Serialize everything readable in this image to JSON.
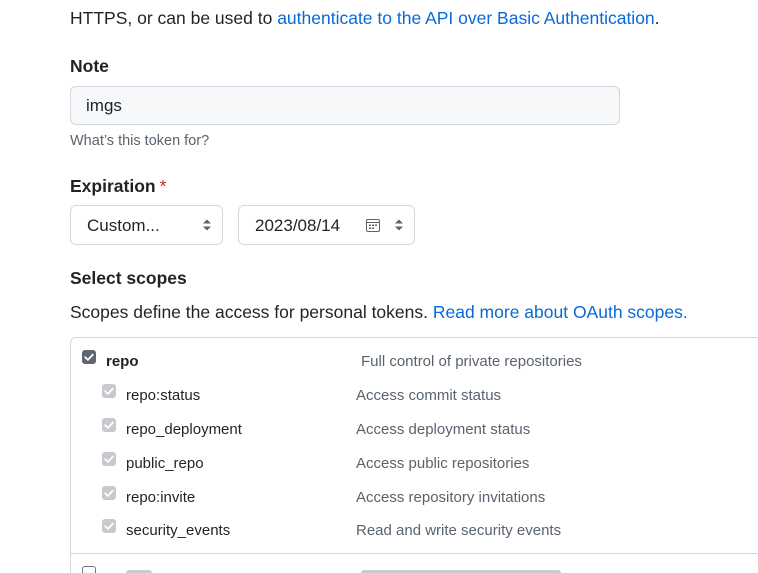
{
  "intro": {
    "text": "HTTPS, or can be used to ",
    "link": "authenticate to the API over Basic Authentication",
    "end": "."
  },
  "note": {
    "label": "Note",
    "value": "imgs",
    "hint": "What’s this token for?"
  },
  "expiration": {
    "label": "Expiration",
    "required_mark": "*",
    "option": "Custom...",
    "date": "2023/08/14"
  },
  "scopes": {
    "title": "Select scopes",
    "description": "Scopes define the access for personal tokens. ",
    "link": "Read more about OAuth scopes.",
    "items": [
      {
        "name": "repo",
        "desc": "Full control of private repositories",
        "checked": true
      },
      {
        "name": "repo:status",
        "desc": "Access commit status",
        "checked": true
      },
      {
        "name": "repo_deployment",
        "desc": "Access deployment status",
        "checked": true
      },
      {
        "name": "public_repo",
        "desc": "Access public repositories",
        "checked": true
      },
      {
        "name": "repo:invite",
        "desc": "Access repository invitations",
        "checked": true
      },
      {
        "name": "security_events",
        "desc": "Read and write security events",
        "checked": true
      }
    ]
  },
  "colors": {
    "link": "#0969da",
    "required": "#cf222e",
    "input_bg": "#f6f8fa",
    "border": "#d0d7de"
  }
}
